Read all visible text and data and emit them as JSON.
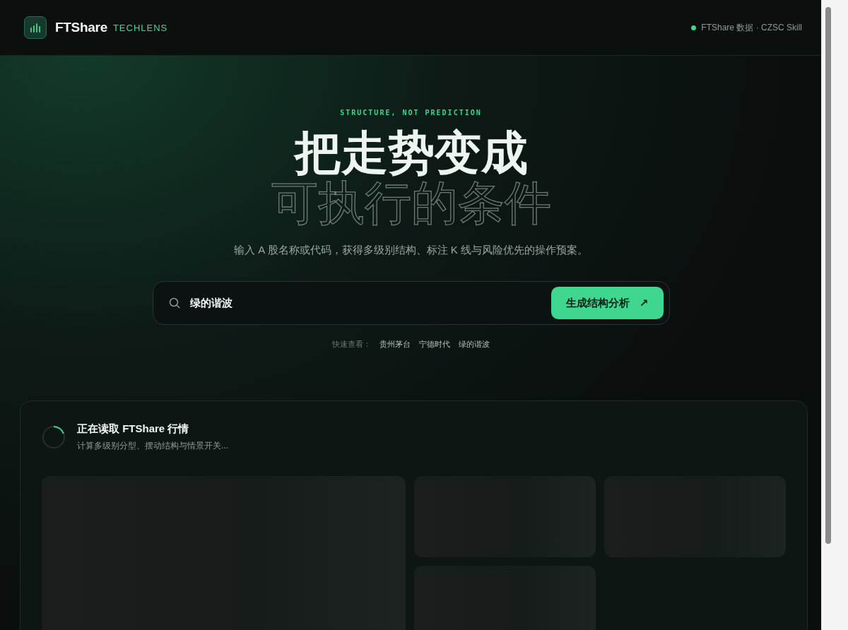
{
  "header": {
    "brand": "FTShare",
    "brand_tag": "TECHLENS",
    "status": "FTShare 数据 · CZSC Skill"
  },
  "hero": {
    "eyebrow": "STRUCTURE, NOT PREDICTION",
    "title_line_1": "把走势变成",
    "title_line_2": "可执行的条件",
    "subtitle": "输入 A 股名称或代码，获得多级别结构、标注 K 线与风险优先的操作预案。"
  },
  "search": {
    "value": "绿的谐波",
    "button": "生成结构分析",
    "button_icon": "↗"
  },
  "quick": {
    "label": "快速查看：",
    "items": [
      "贵州茅台",
      "宁德时代",
      "绿的谐波"
    ]
  },
  "loading": {
    "title": "正在读取 FTShare 行情",
    "subtitle": "计算多级别分型、摆动结构与情景开关..."
  }
}
